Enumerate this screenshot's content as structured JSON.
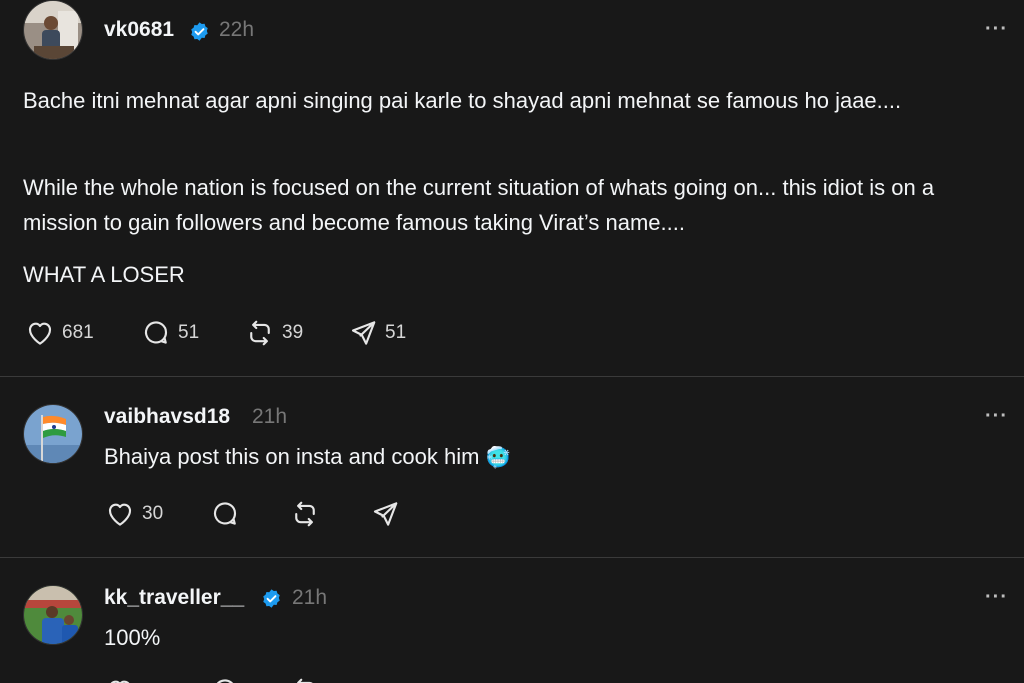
{
  "posts": [
    {
      "username": "vk0681",
      "verified": true,
      "time": "22h",
      "paragraphs": [
        "Bache itni mehnat agar apni singing pai karle to shayad apni mehnat se famous ho jaae....",
        "While the whole nation is focused on the current situation of whats going on... this idiot is on a mission to gain followers and become famous taking Virat’s name....",
        "WHAT A LOSER"
      ],
      "likes": "681",
      "replies": "51",
      "reposts": "39",
      "shares": "51"
    },
    {
      "username": "vaibhavsd18",
      "verified": false,
      "time": "21h",
      "text": "Bhaiya post this on insta and cook him",
      "emoji": "🥶",
      "likes": "30"
    },
    {
      "username": "kk_traveller__",
      "verified": true,
      "time": "21h",
      "text": "100%"
    }
  ],
  "more_label": "···",
  "colors": {
    "background": "#181818",
    "text": "#f3f5f7",
    "muted": "#777777",
    "verified": "#1d9bf0"
  }
}
